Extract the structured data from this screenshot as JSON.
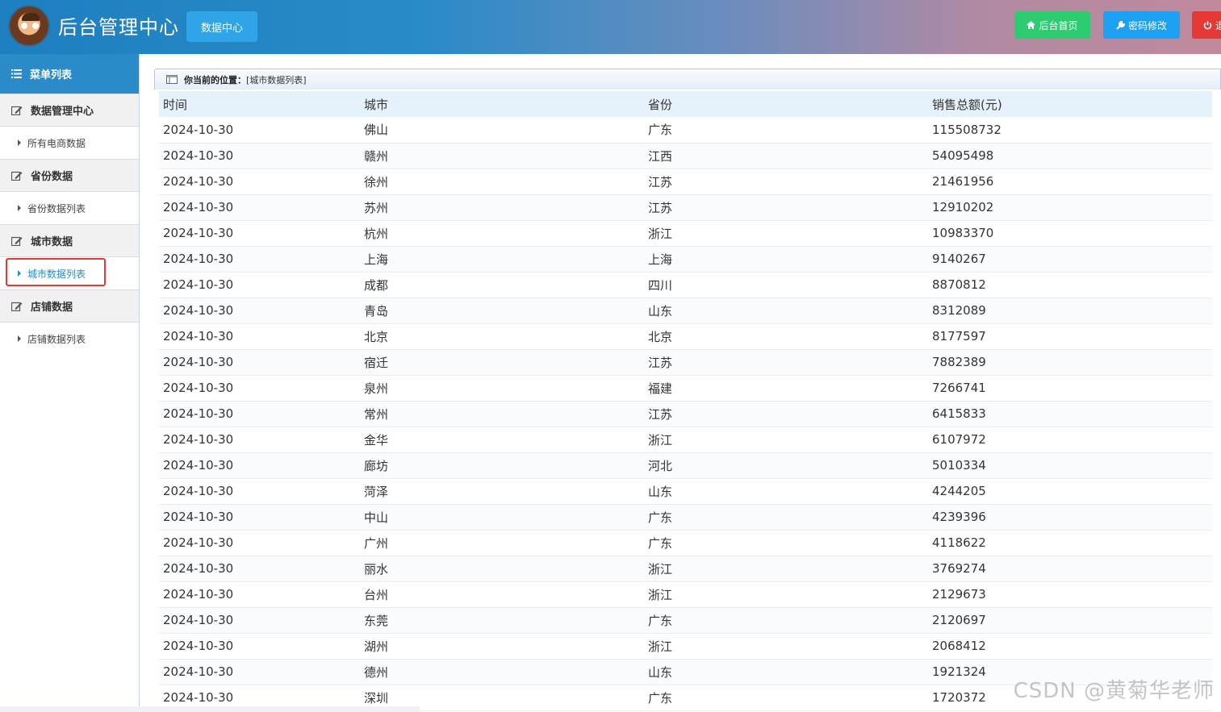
{
  "header": {
    "site_title": "后台管理中心",
    "top_tab": "数据中心",
    "buttons": {
      "home": "后台首页",
      "password": "密码修改",
      "exit": "退"
    }
  },
  "sidebar": {
    "title": "菜单列表",
    "groups": [
      {
        "label": "数据管理中心",
        "items": [
          "所有电商数据"
        ]
      },
      {
        "label": "省份数据",
        "items": [
          "省份数据列表"
        ]
      },
      {
        "label": "城市数据",
        "items": [
          "城市数据列表"
        ],
        "active_item": "城市数据列表"
      },
      {
        "label": "店铺数据",
        "items": [
          "店铺数据列表"
        ]
      }
    ]
  },
  "breadcrumb": {
    "label": "你当前的位置：",
    "value": "[城市数据列表]"
  },
  "table": {
    "columns": [
      "时间",
      "城市",
      "省份",
      "销售总额(元)"
    ],
    "rows": [
      [
        "2024-10-30",
        "佛山",
        "广东",
        "115508732"
      ],
      [
        "2024-10-30",
        "赣州",
        "江西",
        "54095498"
      ],
      [
        "2024-10-30",
        "徐州",
        "江苏",
        "21461956"
      ],
      [
        "2024-10-30",
        "苏州",
        "江苏",
        "12910202"
      ],
      [
        "2024-10-30",
        "杭州",
        "浙江",
        "10983370"
      ],
      [
        "2024-10-30",
        "上海",
        "上海",
        "9140267"
      ],
      [
        "2024-10-30",
        "成都",
        "四川",
        "8870812"
      ],
      [
        "2024-10-30",
        "青岛",
        "山东",
        "8312089"
      ],
      [
        "2024-10-30",
        "北京",
        "北京",
        "8177597"
      ],
      [
        "2024-10-30",
        "宿迁",
        "江苏",
        "7882389"
      ],
      [
        "2024-10-30",
        "泉州",
        "福建",
        "7266741"
      ],
      [
        "2024-10-30",
        "常州",
        "江苏",
        "6415833"
      ],
      [
        "2024-10-30",
        "金华",
        "浙江",
        "6107972"
      ],
      [
        "2024-10-30",
        "廊坊",
        "河北",
        "5010334"
      ],
      [
        "2024-10-30",
        "菏泽",
        "山东",
        "4244205"
      ],
      [
        "2024-10-30",
        "中山",
        "广东",
        "4239396"
      ],
      [
        "2024-10-30",
        "广州",
        "广东",
        "4118622"
      ],
      [
        "2024-10-30",
        "丽水",
        "浙江",
        "3769274"
      ],
      [
        "2024-10-30",
        "台州",
        "浙江",
        "2129673"
      ],
      [
        "2024-10-30",
        "东莞",
        "广东",
        "2120697"
      ],
      [
        "2024-10-30",
        "湖州",
        "浙江",
        "2068412"
      ],
      [
        "2024-10-30",
        "德州",
        "山东",
        "1921324"
      ],
      [
        "2024-10-30",
        "深圳",
        "广东",
        "1720372"
      ]
    ]
  },
  "watermark": "CSDN @黄菊华老师",
  "colors": {
    "header_blue": "#2a8bc8",
    "tab_blue": "#2fa4e7",
    "home_green": "#2ecc71",
    "pwd_blue": "#1da1f2",
    "exit_red": "#e53935",
    "highlight_red": "#e53935"
  }
}
